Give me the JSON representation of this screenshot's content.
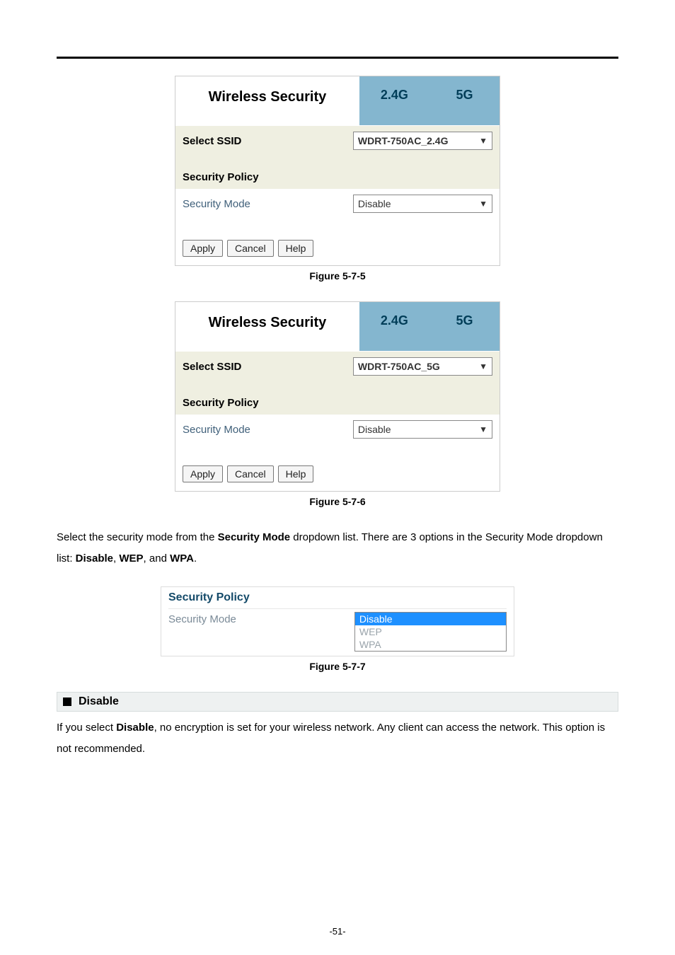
{
  "page_number_label": "-51-",
  "fig1": {
    "title": "Wireless Security",
    "tab_24": "2.4G",
    "tab_5": "5G",
    "select_ssid_label": "Select SSID",
    "select_ssid_value": "WDRT-750AC_2.4G",
    "security_policy_label": "Security Policy",
    "security_mode_label": "Security Mode",
    "security_mode_value": "Disable",
    "btn_apply": "Apply",
    "btn_cancel": "Cancel",
    "btn_help": "Help",
    "caption": "Figure 5-7-5"
  },
  "fig2": {
    "title": "Wireless Security",
    "tab_24": "2.4G",
    "tab_5": "5G",
    "select_ssid_label": "Select SSID",
    "select_ssid_value": "WDRT-750AC_5G",
    "security_policy_label": "Security Policy",
    "security_mode_label": "Security Mode",
    "security_mode_value": "Disable",
    "btn_apply": "Apply",
    "btn_cancel": "Cancel",
    "btn_help": "Help",
    "caption": "Figure 5-7-6"
  },
  "para1": {
    "t1": "Select the security mode from the ",
    "b1": "Security Mode",
    "t2": " dropdown list. There are 3 options in the Security Mode dropdown list: ",
    "b2": "Disable",
    "t3": ", ",
    "b3": "WEP",
    "t4": ", and ",
    "b4": "WPA",
    "t5": "."
  },
  "fig3": {
    "security_policy_label": "Security Policy",
    "security_mode_label": "Security Mode",
    "opt_disable": "Disable",
    "opt_wep": "WEP",
    "opt_wpa": "WPA",
    "caption": "Figure 5-7-7"
  },
  "subheading_disable": "Disable",
  "para2": {
    "t1": "If you select ",
    "b1": "Disable",
    "t2": ", no encryption is set for your wireless network. Any client can access the network. This option is not recommended."
  }
}
